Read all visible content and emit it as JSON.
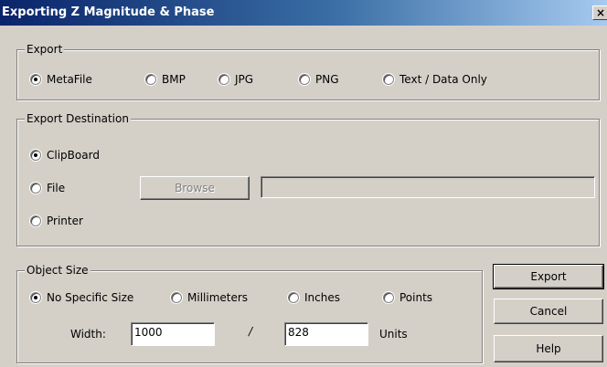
{
  "window": {
    "title": "Exporting Z Magnitude & Phase",
    "close_label": "×"
  },
  "export_group": {
    "legend": "Export",
    "options": [
      {
        "label": "MetaFile",
        "checked": true
      },
      {
        "label": "BMP",
        "checked": false
      },
      {
        "label": "JPG",
        "checked": false
      },
      {
        "label": "PNG",
        "checked": false
      },
      {
        "label": "Text / Data Only",
        "checked": false
      }
    ]
  },
  "destination_group": {
    "legend": "Export Destination",
    "options": [
      {
        "label": "ClipBoard",
        "checked": true
      },
      {
        "label": "File",
        "checked": false
      },
      {
        "label": "Printer",
        "checked": false
      }
    ],
    "browse_label": "Browse",
    "file_path": ""
  },
  "size_group": {
    "legend": "Object Size",
    "options": [
      {
        "label": "No Specific Size",
        "checked": true
      },
      {
        "label": "Millimeters",
        "checked": false
      },
      {
        "label": "Inches",
        "checked": false
      },
      {
        "label": "Points",
        "checked": false
      }
    ],
    "width_label": "Width:",
    "width_value": "1000",
    "separator": "/",
    "height_value": "828",
    "units_label": "Units"
  },
  "buttons": {
    "export": "Export",
    "cancel": "Cancel",
    "help": "Help"
  }
}
